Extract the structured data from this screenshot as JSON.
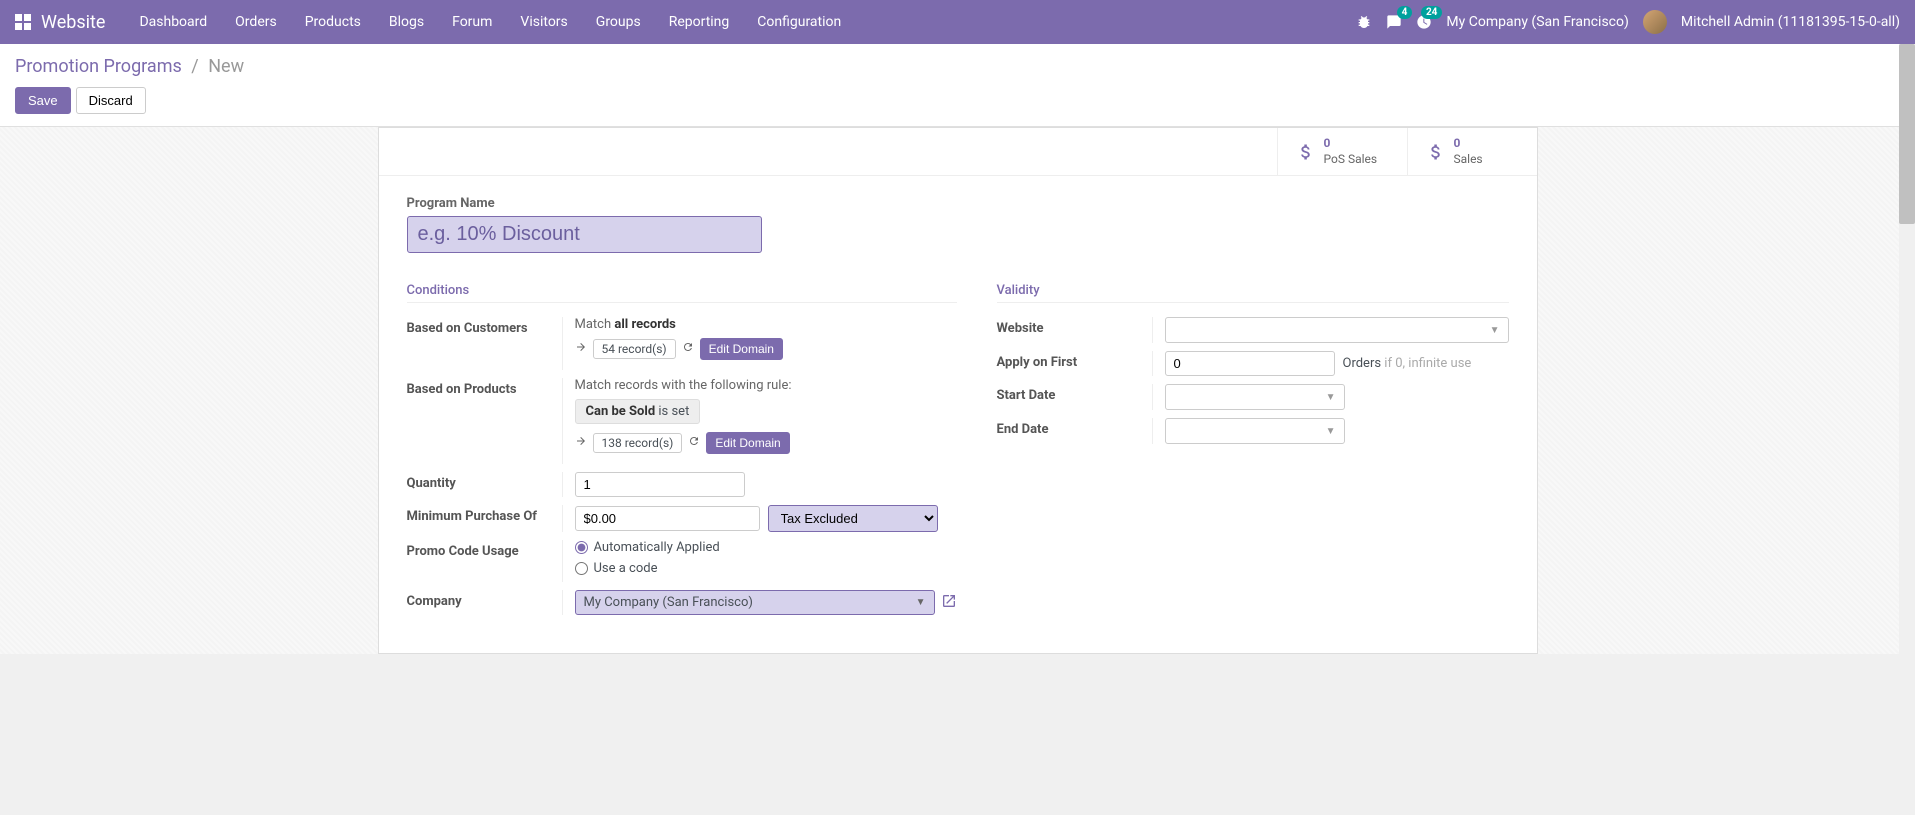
{
  "navbar": {
    "brand": "Website",
    "menu": [
      "Dashboard",
      "Orders",
      "Products",
      "Blogs",
      "Forum",
      "Visitors",
      "Groups",
      "Reporting",
      "Configuration"
    ],
    "messages_badge": "4",
    "activities_badge": "24",
    "company": "My Company (San Francisco)",
    "user": "Mitchell Admin (11181395-15-0-all)"
  },
  "breadcrumb": {
    "parent": "Promotion Programs",
    "current": "New"
  },
  "buttons": {
    "save": "Save",
    "discard": "Discard",
    "edit_domain": "Edit Domain"
  },
  "stats": {
    "pos": {
      "value": "0",
      "label": "PoS Sales"
    },
    "sales": {
      "value": "0",
      "label": "Sales"
    }
  },
  "form": {
    "program_name_label": "Program Name",
    "program_name_placeholder": "e.g. 10% Discount",
    "conditions_title": "Conditions",
    "validity_title": "Validity",
    "based_customers_label": "Based on Customers",
    "match_prefix": "Match ",
    "match_all": "all records",
    "customers_count": "54 record(s)",
    "based_products_label": "Based on Products",
    "match_rule_text": "Match records with the following rule:",
    "rule_field": "Can be Sold",
    "rule_suffix": " is set",
    "products_count": "138 record(s)",
    "quantity_label": "Quantity",
    "quantity_value": "1",
    "min_purchase_label": "Minimum Purchase Of",
    "min_purchase_value": "$0.00",
    "tax_option": "Tax Excluded",
    "promo_code_label": "Promo Code Usage",
    "promo_auto": "Automatically Applied",
    "promo_code": "Use a code",
    "company_label": "Company",
    "company_value": "My Company (San Francisco)",
    "website_label": "Website",
    "apply_first_label": "Apply on First",
    "apply_first_value": "0",
    "orders_text": "Orders",
    "orders_hint": " if 0, infinite use",
    "start_date_label": "Start Date",
    "end_date_label": "End Date"
  }
}
